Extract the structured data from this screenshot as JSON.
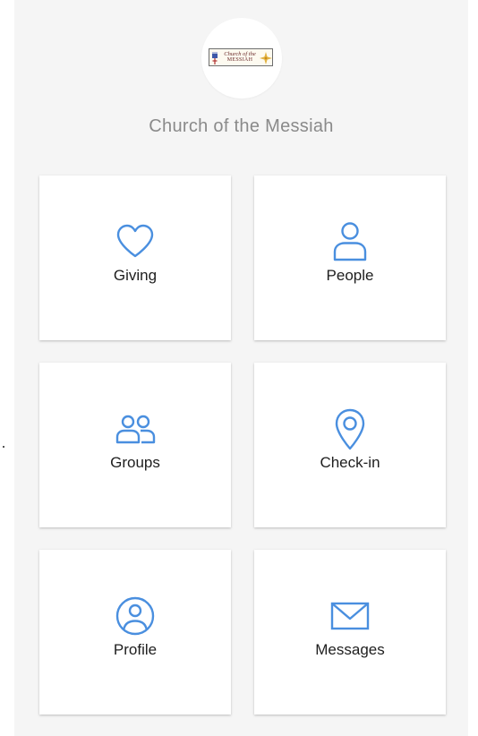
{
  "header": {
    "church_name": "Church of the Messiah",
    "logo_text_line1": "Church of the",
    "logo_text_line2": "MESSIAH"
  },
  "tiles": [
    {
      "label": "Giving",
      "icon": "heart-icon"
    },
    {
      "label": "People",
      "icon": "person-icon"
    },
    {
      "label": "Groups",
      "icon": "group-icon"
    },
    {
      "label": "Check-in",
      "icon": "map-pin-icon"
    },
    {
      "label": "Profile",
      "icon": "user-circle-icon"
    },
    {
      "label": "Messages",
      "icon": "envelope-icon"
    }
  ],
  "colors": {
    "accent": "#4a8fdf",
    "background": "#f5f5f5",
    "tile": "#ffffff",
    "title_text": "#8a8a8a",
    "label_text": "#1e1e1e"
  }
}
